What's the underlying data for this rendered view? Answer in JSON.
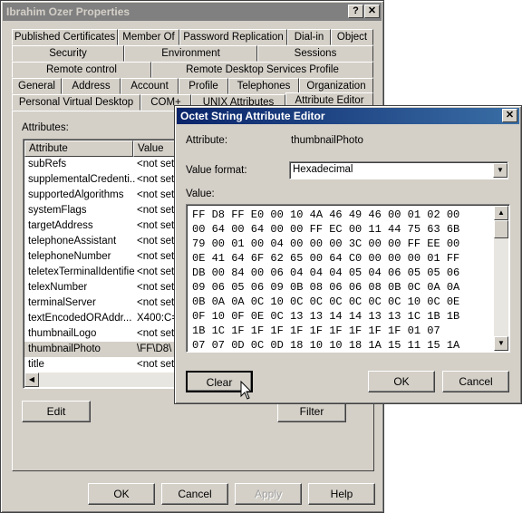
{
  "properties": {
    "title": "Ibrahim Ozer Properties",
    "help_label": "?",
    "close_label": "✕",
    "tabs_row1": [
      "Published Certificates",
      "Member Of",
      "Password Replication",
      "Dial-in",
      "Object"
    ],
    "tabs_row2": [
      "Security",
      "Environment",
      "Sessions"
    ],
    "tabs_row3": [
      "Remote control",
      "Remote Desktop Services Profile"
    ],
    "tabs_row4": [
      "General",
      "Address",
      "Account",
      "Profile",
      "Telephones",
      "Organization"
    ],
    "tabs_row5": [
      "Personal Virtual Desktop",
      "COM+",
      "UNIX Attributes",
      "Attribute Editor"
    ],
    "attributes_label": "Attributes:",
    "columns": [
      "Attribute",
      "Value"
    ],
    "rows": [
      [
        "subRefs",
        "<not set>"
      ],
      [
        "supplementalCredenti...",
        "<not set>"
      ],
      [
        "supportedAlgorithms",
        "<not set>"
      ],
      [
        "systemFlags",
        "<not set>"
      ],
      [
        "targetAddress",
        "<not set>"
      ],
      [
        "telephoneAssistant",
        "<not set>"
      ],
      [
        "telephoneNumber",
        "<not set>"
      ],
      [
        "teletexTerminalIdentifier",
        "<not set>"
      ],
      [
        "telexNumber",
        "<not set>"
      ],
      [
        "terminalServer",
        "<not set>"
      ],
      [
        "textEncodedORAddr...",
        "X400:C="
      ],
      [
        "thumbnailLogo",
        "<not set>"
      ],
      [
        "thumbnailPhoto",
        "\\FF\\D8\\"
      ],
      [
        "title",
        "<not set>"
      ]
    ],
    "edit_label": "Edit",
    "filter_label": "Filter",
    "ok_label": "OK",
    "cancel_label": "Cancel",
    "apply_label": "Apply",
    "help_btn_label": "Help"
  },
  "editor": {
    "title": "Octet String Attribute Editor",
    "close_label": "✕",
    "attribute_label": "Attribute:",
    "attribute_value": "thumbnailPhoto",
    "format_label": "Value format:",
    "format_value": "Hexadecimal",
    "value_label": "Value:",
    "hex_lines": [
      "FF D8 FF E0 00 10 4A 46 49 46 00 01 02 00",
      "00 64 00 64 00 00 FF EC 00 11 44 75 63 6B",
      "79 00 01 00 04 00 00 00 3C 00 00 FF EE 00",
      "0E 41 64 6F 62 65 00 64 C0 00 00 00 01 FF",
      "DB 00 84 00 06 04 04 04 05 04 06 05 05 06",
      "09 06 05 06 09 0B 08 06 06 08 0B 0C 0A 0A",
      "0B 0A 0A 0C 10 0C 0C 0C 0C 0C 0C 10 0C 0E",
      "0F 10 0F 0E 0C 13 13 14 14 13 13 1C 1B 1B",
      "1B 1C 1F 1F 1F 1F 1F 1F 1F 1F 1F 01 07",
      "07 07 0D 0C 0D 18 10 10 18 1A 15 11 15 1A"
    ],
    "clear_label": "Clear",
    "ok_label": "OK",
    "cancel_label": "Cancel"
  }
}
